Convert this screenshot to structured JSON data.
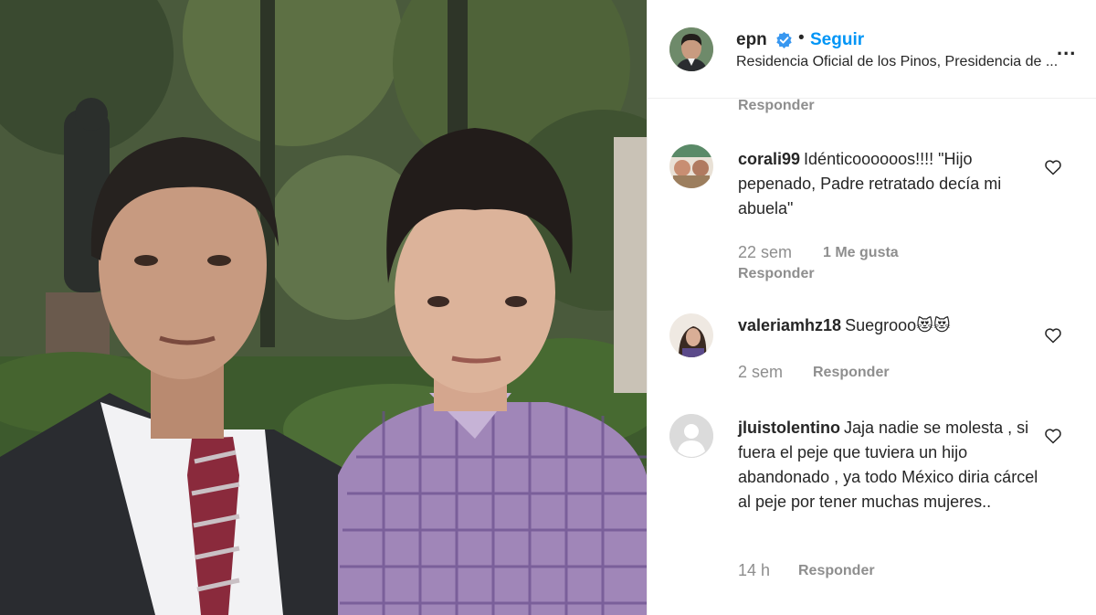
{
  "header": {
    "username": "epn",
    "separator": "•",
    "follow_label": "Seguir",
    "location": "Residencia Oficial de los Pinos, Presidencia de ...",
    "more_label": "..."
  },
  "reply_label": "Responder",
  "comments": [
    {
      "user": "corali99",
      "text": "Idénticoooooos!!!! \"Hijo pepenado, Padre retratado decía mi abuela\"",
      "time": "22 sem",
      "likes": "1 Me gusta"
    },
    {
      "user": "valeriamhz18",
      "text": "Suegrooo😻😻",
      "time": "2 sem",
      "likes": ""
    },
    {
      "user": "jluistolentino",
      "text": "Jaja nadie se molesta , si fuera el peje que tuviera un hijo abandonado , ya todo México diria cárcel al peje por tener muchas mujeres..",
      "time": "14 h",
      "likes": ""
    }
  ],
  "colors": {
    "accent": "#0095f6",
    "muted": "#8e8e8e",
    "text": "#262626",
    "border": "#efefef"
  },
  "icons": {
    "verified": "verified-badge-icon",
    "like": "heart-icon",
    "more": "more-options-icon"
  }
}
